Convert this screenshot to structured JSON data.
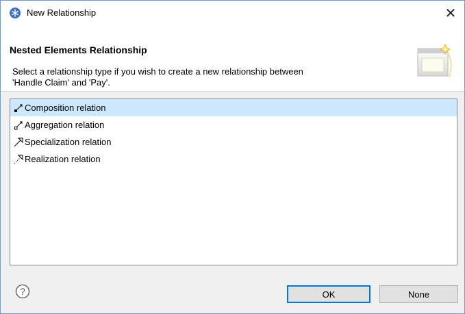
{
  "window": {
    "title": "New Relationship",
    "close_glyph": "✕",
    "icon": "app-snowflake-icon"
  },
  "header": {
    "title": "Nested Elements Relationship",
    "message_line1": "Select a relationship type if you wish to create a new relationship between",
    "message_line2": "'Handle Claim' and 'Pay'."
  },
  "relationships": [
    {
      "label": "Composition relation",
      "icon": "composition-icon",
      "selected": true
    },
    {
      "label": "Aggregation relation",
      "icon": "aggregation-icon",
      "selected": false
    },
    {
      "label": "Specialization relation",
      "icon": "specialization-icon",
      "selected": false
    },
    {
      "label": "Realization relation",
      "icon": "realization-icon",
      "selected": false
    }
  ],
  "buttons": {
    "ok": "OK",
    "none": "None",
    "help": "?"
  },
  "colors": {
    "accent": "#0078d7",
    "selection": "#cce8ff",
    "window_border": "#6b9bd1"
  }
}
